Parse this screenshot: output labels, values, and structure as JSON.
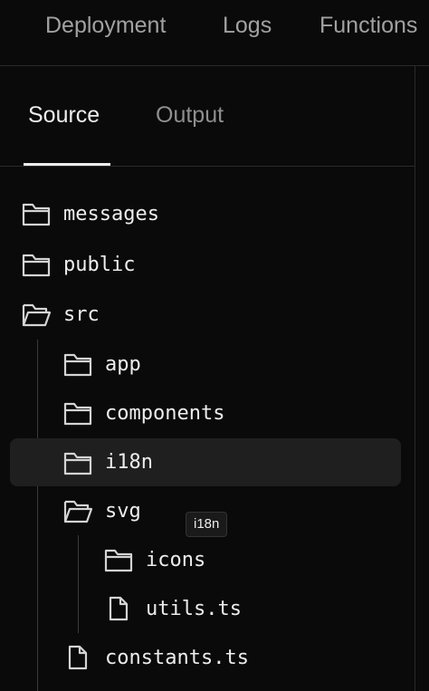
{
  "top_nav": {
    "items": [
      "Deployment",
      "Logs",
      "Functions"
    ]
  },
  "tabs": {
    "items": [
      {
        "label": "Source",
        "active": true
      },
      {
        "label": "Output",
        "active": false
      }
    ]
  },
  "tree": {
    "items": [
      {
        "name": "messages",
        "type": "folder"
      },
      {
        "name": "public",
        "type": "folder"
      },
      {
        "name": "src",
        "type": "folder-open"
      },
      {
        "name": "app",
        "type": "folder"
      },
      {
        "name": "components",
        "type": "folder"
      },
      {
        "name": "i18n",
        "type": "folder",
        "selected": true
      },
      {
        "name": "svg",
        "type": "folder-open"
      },
      {
        "name": "icons",
        "type": "folder"
      },
      {
        "name": "utils.ts",
        "type": "file"
      },
      {
        "name": "constants.ts",
        "type": "file"
      }
    ]
  },
  "tooltip": {
    "text": "i18n"
  },
  "colors": {
    "background": "#0a0a0a",
    "text": "#ededed",
    "muted": "#a1a1a1",
    "selected_row": "#1f1f1f",
    "border": "#2a2a2a"
  }
}
